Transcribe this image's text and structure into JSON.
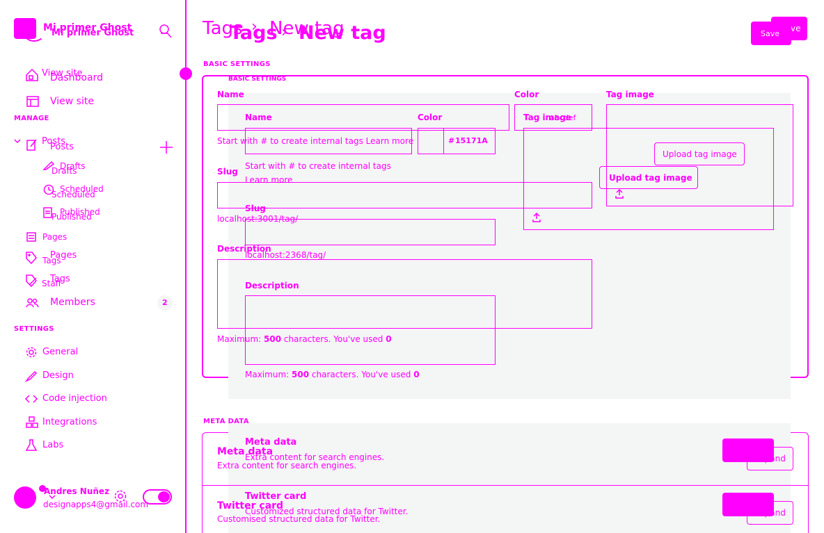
{
  "site": {
    "name": "Mi primer Ghost",
    "name_ghost": "Mi primer Ghost"
  },
  "nav": {
    "view_site": "View site",
    "dashboard": "Dashboard",
    "view_site_2": "View site",
    "manage_heading": "MANAGE",
    "posts": "Posts",
    "posts_2": "Posts",
    "drafts": "Drafts",
    "drafts_2": "Drafts",
    "scheduled": "Scheduled",
    "scheduled_2": "Scheduled",
    "published": "Published",
    "published_2": "Published",
    "pages": "Pages",
    "pages_2": "Pages",
    "tags": "Tags",
    "tags_2": "Tags",
    "staff": "Staff",
    "members": "Members",
    "members_count": "2",
    "settings_heading": "SETTINGS",
    "general": "General",
    "design": "Design",
    "code_injection": "Code injection",
    "integrations": "Integrations",
    "labs": "Labs"
  },
  "user": {
    "name": "Andres Nuñez",
    "email": "designapps4@gmail.com"
  },
  "header": {
    "breadcrumb_a": "Tags",
    "sep_a": "›",
    "title_a": "New tag",
    "breadcrumb_b": "Tags",
    "sep_b": "›",
    "title_b": "New tag",
    "save_a": "Save",
    "save_b": "Save"
  },
  "basic": {
    "heading_a": "BASIC SETTINGS",
    "heading_b": "BASIC SETTINGS",
    "name_label_a": "Name",
    "name_label_b": "Name",
    "color_label_a": "Color",
    "color_label_b": "Color",
    "color_value_a": "abcdef",
    "color_value_b": "15171A",
    "hash": "#",
    "tag_image_label_a": "Tag image",
    "tag_image_label_b": "Tag image",
    "name_help_a": "Start with # to create internal tags Learn more",
    "name_help_b": "Start with # to create internal tags Learn more",
    "upload_a": "Upload tag image",
    "upload_b": "Upload tag image",
    "slug_label_a": "Slug",
    "slug_label_b": "Slug",
    "slug_url_a": "localhost:3001/tag/",
    "slug_url_b": "localhost:2368/tag/",
    "desc_label_a": "Description",
    "desc_label_b": "Description",
    "desc_help_prefix": "Maximum:",
    "desc_help_max": "500",
    "desc_help_mid": "characters. You've used",
    "desc_help_used": "0"
  },
  "meta": {
    "heading": "META DATA",
    "meta_title_a": "Meta data",
    "meta_title_b": "Meta data",
    "meta_desc_a": "Extra content for search engines.",
    "meta_desc_b": "Extra content for search engines.",
    "twitter_title_a": "Twitter card",
    "twitter_title_b": "Twitter card",
    "twitter_desc_a": "Customized structured data for Twitter.",
    "twitter_desc_b": "Customised structured data for Twitter.",
    "expand": "Expand",
    "expand_2": "Expand"
  },
  "colors": {
    "accent": "#ff00ff",
    "panel": "#f4f5f5",
    "background": "#ffffff"
  }
}
